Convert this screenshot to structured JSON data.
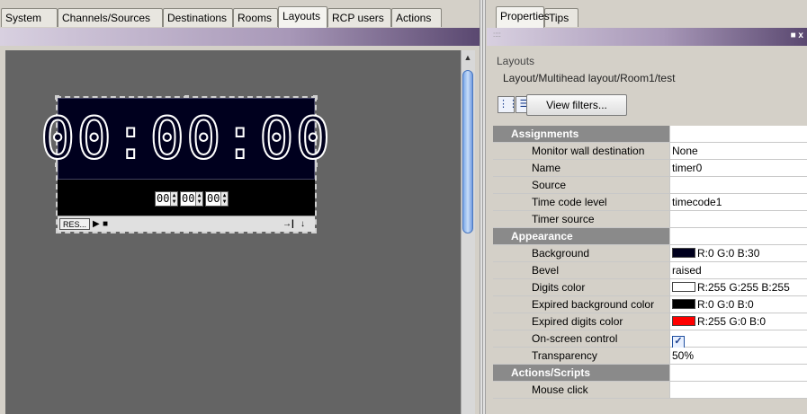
{
  "left_tabs": [
    "System",
    "Channels/Sources",
    "Destinations",
    "Rooms",
    "Layouts",
    "RCP users",
    "Actions"
  ],
  "active_left_tab": "Layouts",
  "timer": {
    "display": "00:00:00",
    "hours": "00",
    "minutes": "00",
    "seconds": "00",
    "reset_label": "RES...",
    "play_icon": "play-icon",
    "stop_icon": "stop-icon",
    "end_icon": "jump-to-end-icon",
    "down_icon": "arrow-down-icon",
    "background_color": "#00001e"
  },
  "right_tabs": [
    "Properties",
    "Tips"
  ],
  "active_right_tab": "Properties",
  "window_controls": "■ x",
  "panel": {
    "heading": "Layouts",
    "path": "Layout/Multihead layout/Room1/test",
    "view_filters_label": "View filters..."
  },
  "property_groups": [
    {
      "name": "Assignments",
      "rows": [
        {
          "key": "Monitor wall destination",
          "value": "None"
        },
        {
          "key": "Name",
          "value": "timer0"
        },
        {
          "key": "Source",
          "value": ""
        },
        {
          "key": "Time code level",
          "value": "timecode1"
        },
        {
          "key": "Timer source",
          "value": ""
        }
      ]
    },
    {
      "name": "Appearance",
      "rows": [
        {
          "key": "Background",
          "value": "R:0 G:0 B:30",
          "swatch": "#00001e"
        },
        {
          "key": "Bevel",
          "value": "raised"
        },
        {
          "key": "Digits color",
          "value": "R:255 G:255 B:255",
          "swatch": "#ffffff"
        },
        {
          "key": "Expired background color",
          "value": "R:0 G:0 B:0",
          "swatch": "#000000"
        },
        {
          "key": "Expired digits color",
          "value": "R:255 G:0 B:0",
          "swatch": "#ff0000"
        },
        {
          "key": "On-screen control",
          "value": "",
          "checked": true
        },
        {
          "key": "Transparency",
          "value": "50%"
        }
      ]
    },
    {
      "name": "Actions/Scripts",
      "rows": [
        {
          "key": "Mouse click",
          "value": ""
        }
      ]
    }
  ]
}
